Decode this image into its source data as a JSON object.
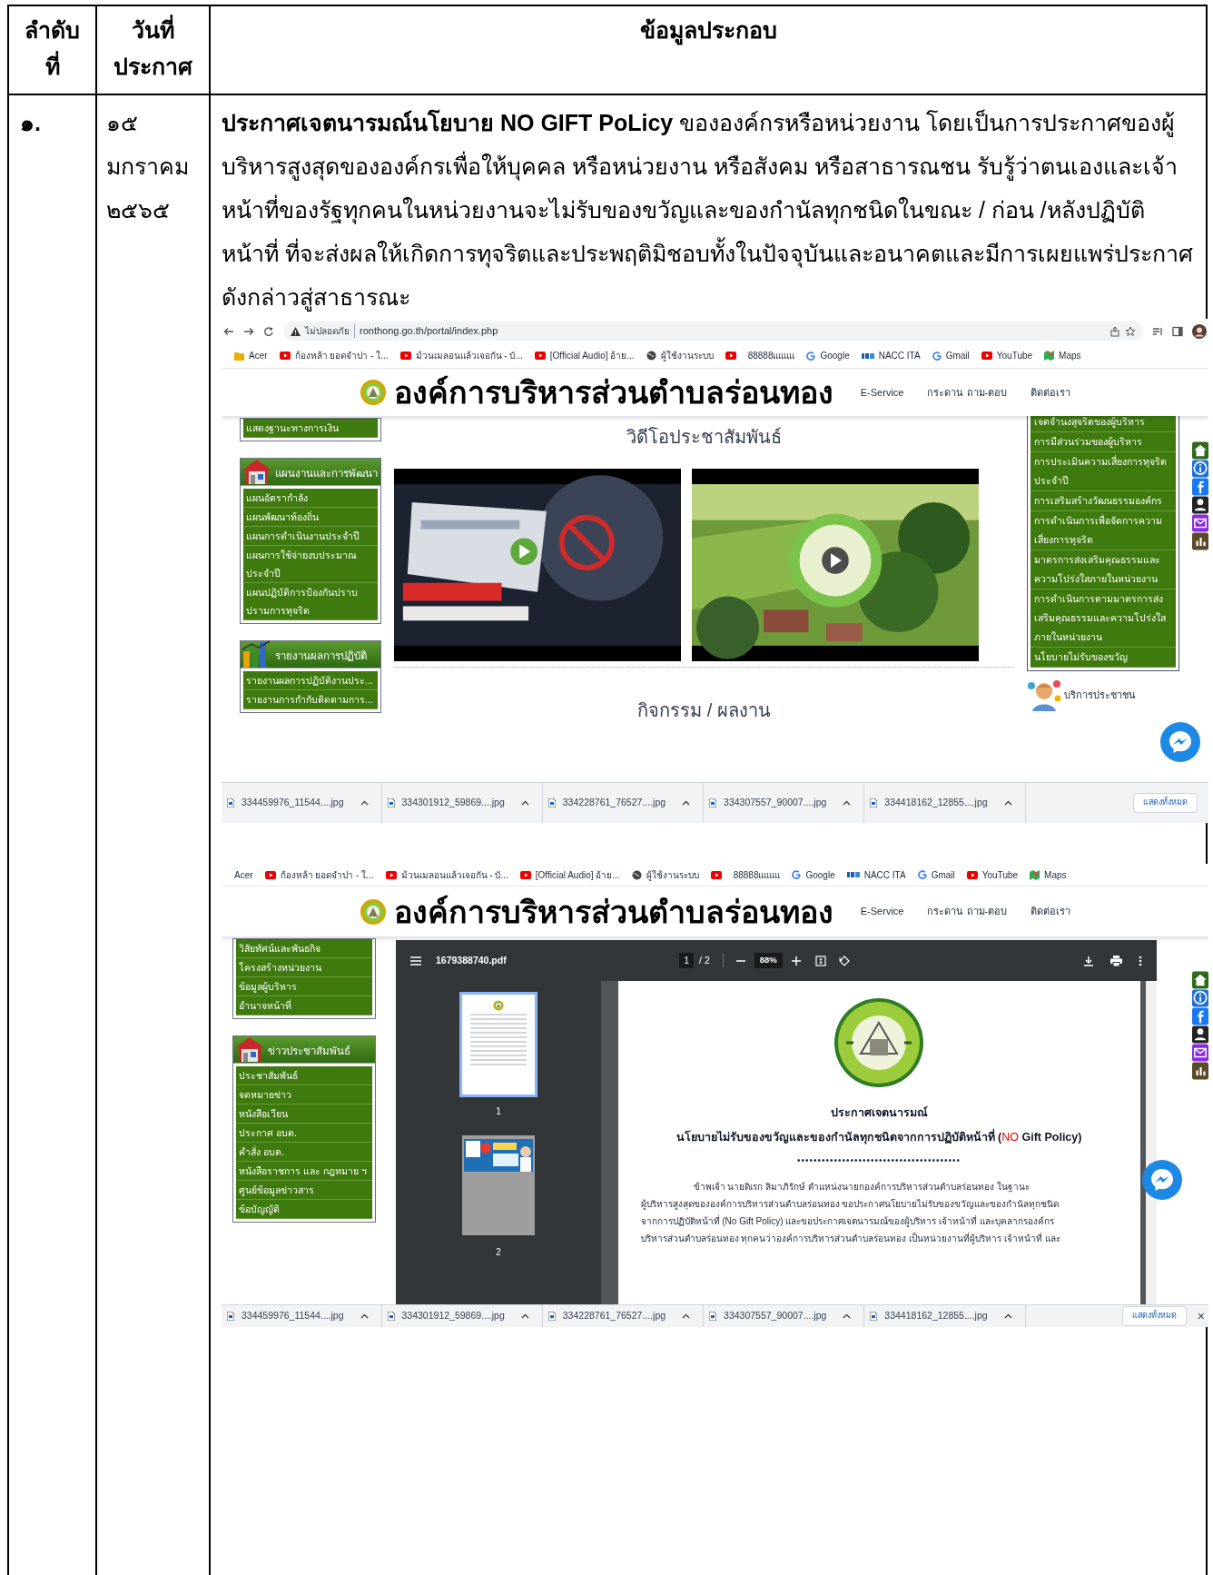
{
  "table": {
    "columns": [
      {
        "lines": [
          "ลำดับ",
          "ที่"
        ]
      },
      {
        "lines": [
          "วันที่",
          "ประกาศ"
        ]
      },
      {
        "lines": [
          "ข้อมูลประกอบ"
        ]
      }
    ],
    "rows": [
      {
        "number": "๑.",
        "date_lines": [
          "๑๕",
          "มกราคม",
          "๒๕๖๕"
        ],
        "description": "**ประกาศเจตนารมณ์นโยบาย NO GIFT PoLicy** ขององค์กรหรือหน่วยงาน โดยเป็นการประกาศของผู้บริหารสูงสุดขององค์กรเพื่อให้บุคคล หรือหน่วยงาน หรือสังคม หรือสาธารณชน รับรู้ว่าตนเองและเจ้าหน้าที่ของรัฐทุกคนในหน่วยงานจะไม่รับของขวัญและของกำนัลทุกชนิดในขณะ / ก่อน /หลังปฏิบัติหน้าที่ ที่จะส่งผลให้เกิดการทุจริตและประพฤติมิชอบทั้งในปัจจุบันและอนาคตและมีการเผยแพร่ประกาศดังกล่าวสู่สาธารณะ",
        "screenshots": [
          {
            "kind": "homepage",
            "security": "ไม่ปลอดภัย",
            "url": "ronthong.go.th/portal/index.php",
            "bookmarks": [
              {
                "kind": "folder",
                "label": "Acer"
              },
              {
                "kind": "youtube",
                "label": "ก้องหล้า ยอดจำปา - ใ..."
              },
              {
                "kind": "youtube",
                "label": "ม้วนเมลอนแล้วเจอกัน - บั..."
              },
              {
                "kind": "youtube",
                "label": "[Official Audio] อ้าย..."
              },
              {
                "kind": "globe",
                "label": "ผู้ใช้งานระบบ"
              },
              {
                "kind": "youtube"
              },
              {
                "kind": "plain",
                "label": "88888แแแแ"
              },
              {
                "kind": "google",
                "label": "Google"
              },
              {
                "kind": "ita",
                "label": "NACC ITA"
              },
              {
                "kind": "google",
                "label": "Gmail"
              },
              {
                "kind": "youtube",
                "label": "YouTube"
              },
              {
                "kind": "maps",
                "label": "Maps"
              }
            ],
            "site_title": "องค์การบริหารส่วนตำบลร่อนทอง",
            "nav": [
              "E-Service",
              "กระดาน ถาม-ตอบ",
              "ติดต่อเรา"
            ],
            "left_sections": [
              {
                "items": [
                  "แสดงฐานะทางการเงิน"
                ]
              },
              {
                "heading": "แผนงานและการพัฒนา",
                "kind": "house",
                "items": [
                  "แผนอัตรากำลัง",
                  "แผนพัฒนาท้องถิ่น",
                  "แผนการดำเนินงานประจำปี",
                  "แผนการใช้จ่ายงบประมาณประจำปี",
                  "แผนปฏิบัติการป้องกันปราบปรามการทุจริต"
                ]
              },
              {
                "heading": "รายงานผลการปฏิบัติ",
                "kind": "chart",
                "items": [
                  "รายงานผลการปฏิบัติงานประ...",
                  "รายงานการกำกับติดตามการ..."
                ]
              }
            ],
            "section_title": "วิดีโอประชาสัมพันธ์",
            "videos": [
              {
                "kind": "picture"
              },
              {
                "kind": "picture"
              }
            ],
            "next_section_title": "กิจกรรม / ผลงาน",
            "right_menu": [
              "เจตจำนงสุจริตของผู้บริหาร",
              "การมีส่วนร่วมของผู้บริหาร",
              "การประเมินความเสี่ยงการทุจริตประจำปี",
              "การเสริมสร้างวัฒนธรรมองค์กร",
              "การดำเนินการเพื่อจัดการความเสี่ยงการทุจริต",
              "มาตรการส่งเสริมคุณธรรมและความโปร่งใสภายในหน่วยงาน",
              "การดำเนินการตามมาตรการส่งเสริมคุณธรรมและความโปร่งใสภายในหน่วยงาน",
              "นโยบายไม่รับของขวัญ"
            ],
            "service_label": "บริการประชาชน",
            "downloads": [
              "334459976_11544....jpg",
              "334301912_59869....jpg",
              "334228761_76527....jpg",
              "334307557_90007....jpg",
              "334418162_12855....jpg"
            ],
            "show_all": "แสดงทั้งหมด"
          },
          {
            "kind": "pdf",
            "bookmarks": [
              {
                "kind": "plain",
                "label": "Acer"
              },
              {
                "kind": "youtube",
                "label": "ก้องหล้า ยอดจำปา - ใ..."
              },
              {
                "kind": "youtube",
                "label": "ม้วนเมลอนแล้วเจอกัน - บั..."
              },
              {
                "kind": "youtube",
                "label": "[Official Audio] อ้าย..."
              },
              {
                "kind": "globe",
                "label": "ผู้ใช้งานระบบ"
              },
              {
                "kind": "youtube"
              },
              {
                "kind": "plain",
                "label": "88888แแแแ"
              },
              {
                "kind": "google",
                "label": "Google"
              },
              {
                "kind": "ita",
                "label": "NACC ITA"
              },
              {
                "kind": "google",
                "label": "Gmail"
              },
              {
                "kind": "youtube",
                "label": "YouTube"
              },
              {
                "kind": "maps",
                "label": "Maps"
              }
            ],
            "site_title": "องค์การบริหารส่วนตำบลร่อนทอง",
            "nav": [
              "E-Service",
              "กระดาน ถาม-ตอบ",
              "ติดต่อเรา"
            ],
            "left_sections": [
              {
                "items": [
                  "วิสัยทัศน์และพันธกิจ",
                  "โครงสร้างหน่วยงาน",
                  "ข้อมูลผู้บริหาร",
                  "อำนาจหน้าที่"
                ]
              },
              {
                "heading": "ข่าวประชาสัมพันธ์",
                "kind": "house",
                "items": [
                  "ประชาสัมพันธ์",
                  "จดหมายข่าว",
                  "หนังสือเวียน",
                  "ประกาศ อบต.",
                  "คำสั่ง อบต.",
                  "หนังสือราชการ และ กฎหมาย ฯ",
                  "ศูนย์ข้อมูลข่าวสาร",
                  "ข้อบัญญัติ"
                ]
              }
            ],
            "pdf": {
              "file": "1679388740.pdf",
              "page": "1",
              "of_pages": "/ 2",
              "zoom": "88%",
              "thumbnails": [
                {
                  "label": "1",
                  "selected": true
                },
                {
                  "label": "2",
                  "selected": false
                }
              ],
              "title": "ประกาศเจตนารมณ์",
              "subtitle_parts": [
                {
                  "text": "นโยบายไม่รับของขวัญและของกำนัลทุกชนิดจากการปฏิบัติหน้าที่ (",
                  "red": false
                },
                {
                  "text": "NO",
                  "red": true
                },
                {
                  "text": " Gift Policy)",
                  "red": false
                }
              ],
              "divider": "••••••••••••••••••••••••••••••••••••••••",
              "body_lines": [
                "ข้าพเจ้า นายดิเรก ลิมาภิรักษ์ ตำแหน่งนายกองค์การบริหารส่วนตำบลร่อนทอง ในฐานะ",
                "ผู้บริหารสูงสุดขององค์การบริหารส่วนตำบลร่อนทอง ขอประกาศนโยบายไม่รับของขวัญและของกำนัลทุกชนิด",
                "จากการปฏิบัติหน้าที่ (No Gift Policy) และขอประกาศเจตนารมณ์ของผู้บริหาร เจ้าหน้าที่ และบุคลากรองค์กร",
                "บริหารส่วนตำบลร่อนทอง ทุกคนว่าองค์การบริหารส่วนตำบลร่อนทอง เป็นหน่วยงานที่ผู้บริหาร เจ้าหน้าที่ และ"
              ]
            },
            "downloads": [
              "334459976_11544....jpg",
              "334301912_59869....jpg",
              "334228761_76527....jpg",
              "334307557_90007....jpg",
              "334418162_12855....jpg"
            ],
            "show_all": "แสดงทั้งหมด",
            "close": "×"
          }
        ]
      }
    ]
  }
}
